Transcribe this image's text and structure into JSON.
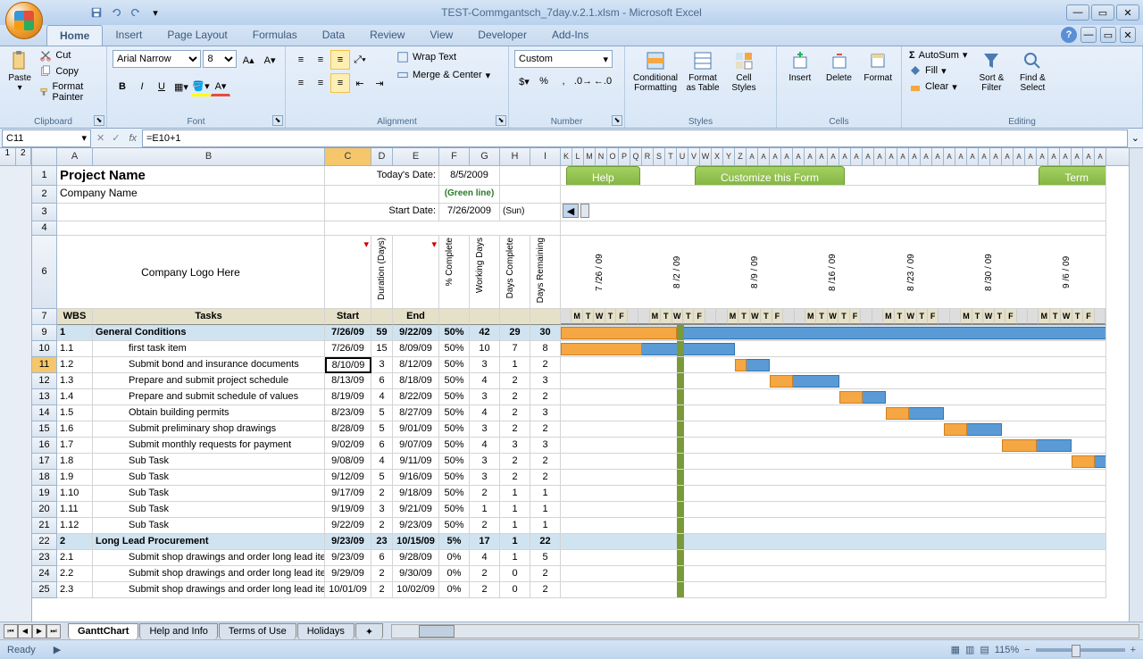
{
  "title": "TEST-Commgantsch_7day.v.2.1.xlsm - Microsoft Excel",
  "tabs": [
    "Home",
    "Insert",
    "Page Layout",
    "Formulas",
    "Data",
    "Review",
    "View",
    "Developer",
    "Add-Ins"
  ],
  "activeTab": "Home",
  "clipboard": {
    "label": "Clipboard",
    "paste": "Paste",
    "cut": "Cut",
    "copy": "Copy",
    "painter": "Format Painter"
  },
  "font": {
    "label": "Font",
    "name": "Arial Narrow",
    "size": "8"
  },
  "alignment": {
    "label": "Alignment",
    "wrap": "Wrap Text",
    "merge": "Merge & Center"
  },
  "number": {
    "label": "Number",
    "format": "Custom"
  },
  "styles": {
    "label": "Styles",
    "cond": "Conditional Formatting",
    "fmt": "Format as Table",
    "cell": "Cell Styles"
  },
  "cells": {
    "label": "Cells",
    "insert": "Insert",
    "delete": "Delete",
    "format": "Format"
  },
  "editing": {
    "label": "Editing",
    "sum": "AutoSum",
    "fill": "Fill",
    "clear": "Clear",
    "sort": "Sort & Filter",
    "find": "Find & Select"
  },
  "nameBox": "C11",
  "formula": "=E10+1",
  "cols": [
    "A",
    "B",
    "C",
    "D",
    "E",
    "F",
    "G",
    "H",
    "I"
  ],
  "ganttCols": "K L M N O P Q R S T U V W X Y Z",
  "project": {
    "name": "Project Name",
    "company": "Company Name",
    "logo": "Company Logo Here"
  },
  "dates": {
    "todayLabel": "Today's Date:",
    "today": "8/5/2009",
    "green": "(Green line)",
    "startLabel": "Start Date:",
    "start": "7/26/2009",
    "startDay": "(Sun)"
  },
  "buttons": {
    "help": "Help",
    "customize": "Customize this Form",
    "term": "Term"
  },
  "headers": {
    "wbs": "WBS",
    "tasks": "Tasks",
    "start": "Start",
    "duration": "Duration (Days)",
    "end": "End",
    "pct": "% Complete",
    "working": "Working Days",
    "daysComplete": "Days Complete",
    "daysRem": "Days Remaining"
  },
  "weeks": [
    "7 /26 / 09",
    "8 /2 / 09",
    "8 /9 / 09",
    "8 /16 / 09",
    "8 /23 / 09",
    "8 /30 / 09",
    "9 /6 / 09"
  ],
  "dayLetters": [
    "M",
    "T",
    "W",
    "T",
    "F"
  ],
  "rows": [
    {
      "r": 9,
      "wbs": "1",
      "task": "General Conditions",
      "start": "7/26/09",
      "dur": "59",
      "end": "9/22/09",
      "pct": "50%",
      "wd": "42",
      "dc": "29",
      "dr": "30",
      "section": true,
      "gs": 0,
      "gw": 47,
      "os": 0,
      "ow": 10
    },
    {
      "r": 10,
      "wbs": "1.1",
      "task": "first task item",
      "start": "7/26/09",
      "dur": "15",
      "end": "8/09/09",
      "pct": "50%",
      "wd": "10",
      "dc": "7",
      "dr": "8",
      "gs": 0,
      "gw": 15,
      "os": 0,
      "ow": 7
    },
    {
      "r": 11,
      "wbs": "1.2",
      "task": "Submit bond and insurance documents",
      "start": "8/10/09",
      "dur": "3",
      "end": "8/12/09",
      "pct": "50%",
      "wd": "3",
      "dc": "1",
      "dr": "2",
      "sel": true,
      "gs": 15,
      "gw": 3,
      "os": 15,
      "ow": 1
    },
    {
      "r": 12,
      "wbs": "1.3",
      "task": "Prepare and submit project schedule",
      "start": "8/13/09",
      "dur": "6",
      "end": "8/18/09",
      "pct": "50%",
      "wd": "4",
      "dc": "2",
      "dr": "3",
      "gs": 18,
      "gw": 6,
      "os": 18,
      "ow": 2
    },
    {
      "r": 13,
      "wbs": "1.4",
      "task": "Prepare and submit schedule of values",
      "start": "8/19/09",
      "dur": "4",
      "end": "8/22/09",
      "pct": "50%",
      "wd": "3",
      "dc": "2",
      "dr": "2",
      "gs": 24,
      "gw": 4,
      "os": 24,
      "ow": 2
    },
    {
      "r": 14,
      "wbs": "1.5",
      "task": "Obtain building permits",
      "start": "8/23/09",
      "dur": "5",
      "end": "8/27/09",
      "pct": "50%",
      "wd": "4",
      "dc": "2",
      "dr": "3",
      "gs": 28,
      "gw": 5,
      "os": 28,
      "ow": 2
    },
    {
      "r": 15,
      "wbs": "1.6",
      "task": "Submit preliminary shop drawings",
      "start": "8/28/09",
      "dur": "5",
      "end": "9/01/09",
      "pct": "50%",
      "wd": "3",
      "dc": "2",
      "dr": "2",
      "gs": 33,
      "gw": 5,
      "os": 33,
      "ow": 2
    },
    {
      "r": 16,
      "wbs": "1.7",
      "task": "Submit monthly requests for payment",
      "start": "9/02/09",
      "dur": "6",
      "end": "9/07/09",
      "pct": "50%",
      "wd": "4",
      "dc": "3",
      "dr": "3",
      "gs": 38,
      "gw": 6,
      "os": 38,
      "ow": 3
    },
    {
      "r": 17,
      "wbs": "1.8",
      "task": "Sub Task",
      "start": "9/08/09",
      "dur": "4",
      "end": "9/11/09",
      "pct": "50%",
      "wd": "3",
      "dc": "2",
      "dr": "2",
      "gs": 44,
      "gw": 4,
      "os": 44,
      "ow": 2
    },
    {
      "r": 18,
      "wbs": "1.9",
      "task": "Sub Task",
      "start": "9/12/09",
      "dur": "5",
      "end": "9/16/09",
      "pct": "50%",
      "wd": "3",
      "dc": "2",
      "dr": "2"
    },
    {
      "r": 19,
      "wbs": "1.10",
      "task": "Sub Task",
      "start": "9/17/09",
      "dur": "2",
      "end": "9/18/09",
      "pct": "50%",
      "wd": "2",
      "dc": "1",
      "dr": "1"
    },
    {
      "r": 20,
      "wbs": "1.11",
      "task": "Sub Task",
      "start": "9/19/09",
      "dur": "3",
      "end": "9/21/09",
      "pct": "50%",
      "wd": "1",
      "dc": "1",
      "dr": "1"
    },
    {
      "r": 21,
      "wbs": "1.12",
      "task": "Sub Task",
      "start": "9/22/09",
      "dur": "2",
      "end": "9/23/09",
      "pct": "50%",
      "wd": "2",
      "dc": "1",
      "dr": "1"
    },
    {
      "r": 22,
      "wbs": "2",
      "task": "Long Lead Procurement",
      "start": "9/23/09",
      "dur": "23",
      "end": "10/15/09",
      "pct": "5%",
      "wd": "17",
      "dc": "1",
      "dr": "22",
      "section": true
    },
    {
      "r": 23,
      "wbs": "2.1",
      "task": "Submit shop drawings and order long lead items - steel",
      "start": "9/23/09",
      "dur": "6",
      "end": "9/28/09",
      "pct": "0%",
      "wd": "4",
      "dc": "1",
      "dr": "5"
    },
    {
      "r": 24,
      "wbs": "2.2",
      "task": "Submit shop drawings and order long lead items - roofing",
      "start": "9/29/09",
      "dur": "2",
      "end": "9/30/09",
      "pct": "0%",
      "wd": "2",
      "dc": "0",
      "dr": "2"
    },
    {
      "r": 25,
      "wbs": "2.3",
      "task": "Submit shop drawings and order long lead items - elevator",
      "start": "10/01/09",
      "dur": "2",
      "end": "10/02/09",
      "pct": "0%",
      "wd": "2",
      "dc": "0",
      "dr": "2"
    }
  ],
  "sheetTabs": [
    "GanttChart",
    "Help and Info",
    "Terms of Use",
    "Holidays"
  ],
  "activeSheet": "GanttChart",
  "status": "Ready",
  "zoom": "115%"
}
